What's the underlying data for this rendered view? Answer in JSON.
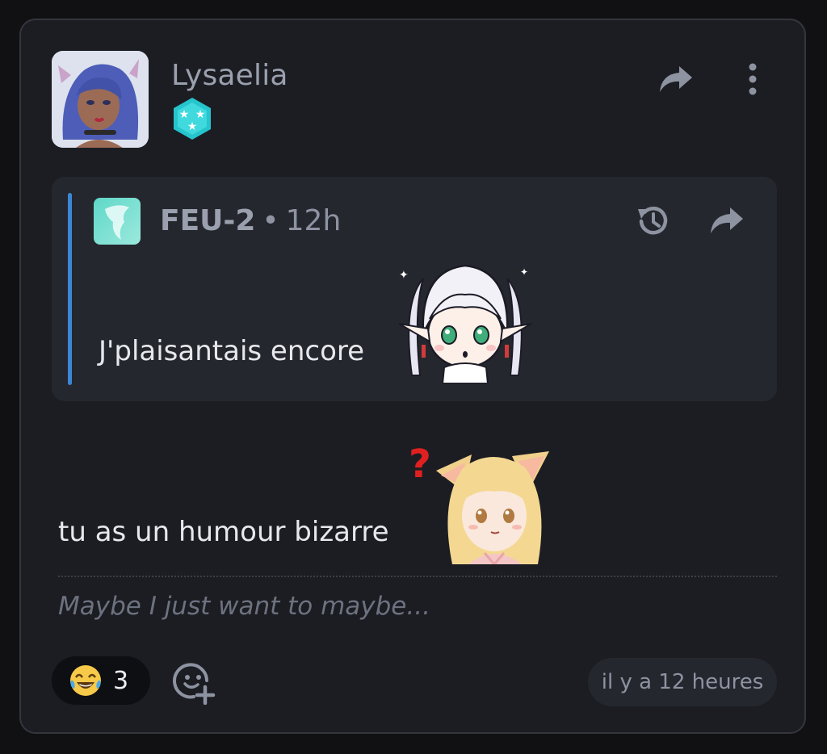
{
  "post": {
    "author_name": "Lysaelia",
    "author_badge_icon": "star-hexagon-icon",
    "share_icon": "share-arrow-icon",
    "more_icon": "more-vertical-icon"
  },
  "quoted": {
    "author_name": "FEU-2",
    "separator": "•",
    "time": "12h",
    "text": "J'plaisantais encore",
    "sticker": "anime-elf-girl-sticker",
    "history_icon": "history-icon",
    "share_icon": "share-arrow-icon",
    "accent_color": "#3b87d6"
  },
  "message": {
    "text": "tu as un humour bizarre",
    "sticker": "fox-girl-question-sticker"
  },
  "signature": "Maybe I just want to maybe...",
  "reactions": {
    "emoji": "😂",
    "count": "3",
    "add_icon": "add-reaction-icon"
  },
  "timestamp": "il y a 12 heures"
}
